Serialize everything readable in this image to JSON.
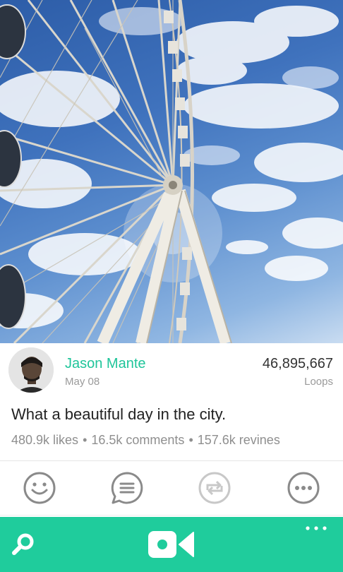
{
  "post": {
    "author_name": "Jason Mante",
    "date": "May 08",
    "loops_count": "46,895,667",
    "loops_label": "Loops",
    "caption": "What a beautiful day in the city.",
    "stats": {
      "likes": "480.9k likes",
      "comments": "16.5k comments",
      "revines": "157.6k revines",
      "separator": "•"
    }
  },
  "actions": [
    {
      "name": "like",
      "icon": "smiley-icon"
    },
    {
      "name": "comment",
      "icon": "comment-icon"
    },
    {
      "name": "revine",
      "icon": "revine-icon"
    },
    {
      "name": "more",
      "icon": "more-icon"
    }
  ],
  "app_bar": {
    "search_icon": "search-icon",
    "record_icon": "video-camera-icon",
    "overflow_icon": "ellipsis-icon"
  },
  "colors": {
    "accent": "#1fc59a",
    "app_bar": "#1fcc9c",
    "action_icon": "#8a8a8a",
    "action_icon_disabled": "#c8c8c8"
  }
}
